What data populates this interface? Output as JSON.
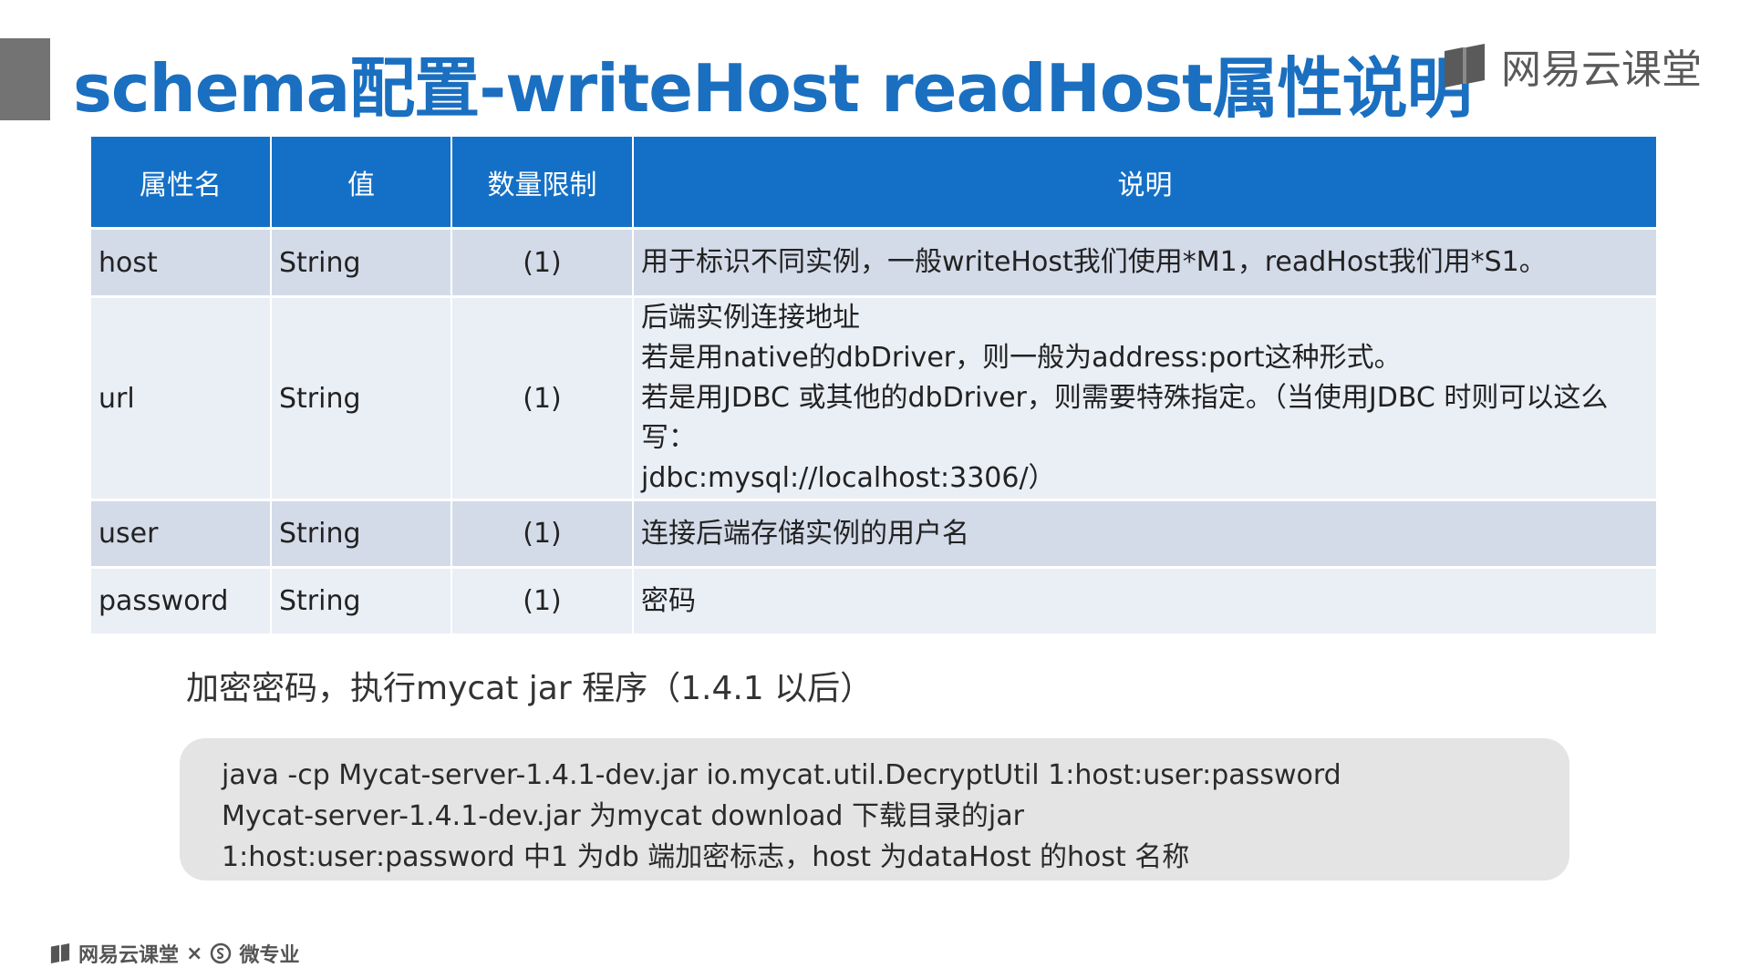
{
  "title": "schema配置-writeHost readHost属性说明",
  "brand": {
    "name": "网易云课堂"
  },
  "table": {
    "headers": [
      "属性名",
      "值",
      "数量限制",
      "说明"
    ],
    "rows": [
      {
        "name": "host",
        "value": "String",
        "limit": "(1)",
        "desc": [
          "用于标识不同实例，一般writeHost我们使用*M1，readHost我们用*S1。"
        ]
      },
      {
        "name": "url",
        "value": "String",
        "limit": "(1)",
        "desc": [
          "后端实例连接地址",
          "若是用native的dbDriver，则一般为address:port这种形式。",
          "若是用JDBC 或其他的dbDriver，则需要特殊指定。（当使用JDBC 时则可以这么写：",
          "jdbc:mysql://localhost:3306/）"
        ]
      },
      {
        "name": "user",
        "value": "String",
        "limit": "(1)",
        "desc": [
          "连接后端存储实例的用户名"
        ]
      },
      {
        "name": "password",
        "value": "String",
        "limit": "(1)",
        "desc": [
          "密码"
        ]
      }
    ]
  },
  "encrypt": {
    "heading": "加密密码，执行mycat jar 程序（1.4.1 以后）",
    "lines": [
      "java -cp Mycat-server-1.4.1-dev.jar io.mycat.util.DecryptUtil 1:host:user:password",
      "Mycat-server-1.4.1-dev.jar 为mycat download 下载目录的jar",
      "1:host:user:password 中1 为db 端加密标志，host 为dataHost 的host 名称"
    ]
  },
  "footer": {
    "brand": "网易云课堂",
    "separator": "×",
    "partner": "微专业"
  },
  "colors": {
    "title": "#1a6fc0",
    "header_bg": "#1470c6",
    "row_odd": "#d3dbe9",
    "row_even": "#eaeef5"
  }
}
